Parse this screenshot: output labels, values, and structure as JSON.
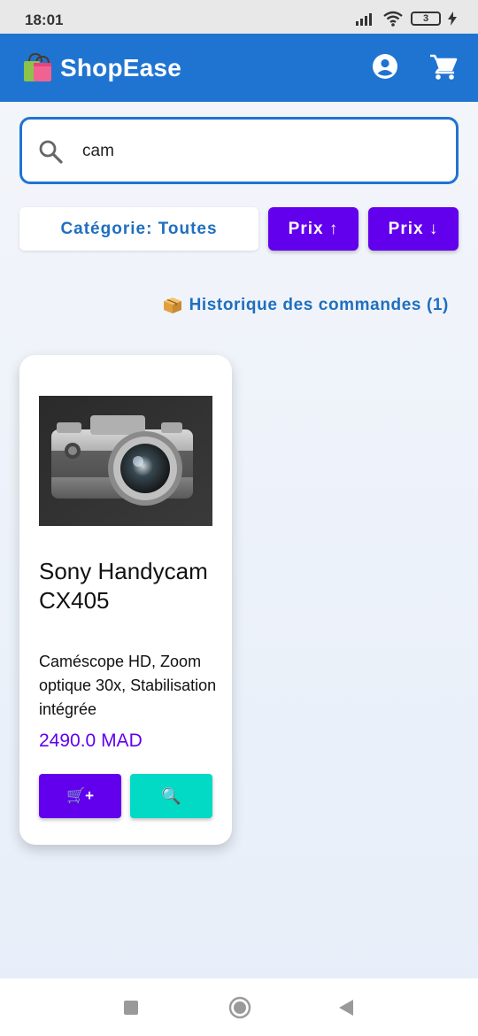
{
  "status_bar": {
    "time": "18:01",
    "battery": "3"
  },
  "app": {
    "title": "ShopEase"
  },
  "search": {
    "value": "cam"
  },
  "filters": {
    "category_label": "Catégorie: Toutes",
    "price_asc_label": "Prix ↑",
    "price_desc_label": "Prix ↓"
  },
  "history": {
    "label": "Historique des commandes (1)"
  },
  "products": [
    {
      "name": "Sony Handycam CX405",
      "description": "Caméscope HD, Zoom optique 30x, Stabilisation intégrée",
      "price": "2490.0 MAD",
      "add_label": "🛒+",
      "view_label": "🔍"
    }
  ],
  "colors": {
    "primary": "#1f74d1",
    "accent": "#6200ee",
    "teal": "#03dac5"
  }
}
